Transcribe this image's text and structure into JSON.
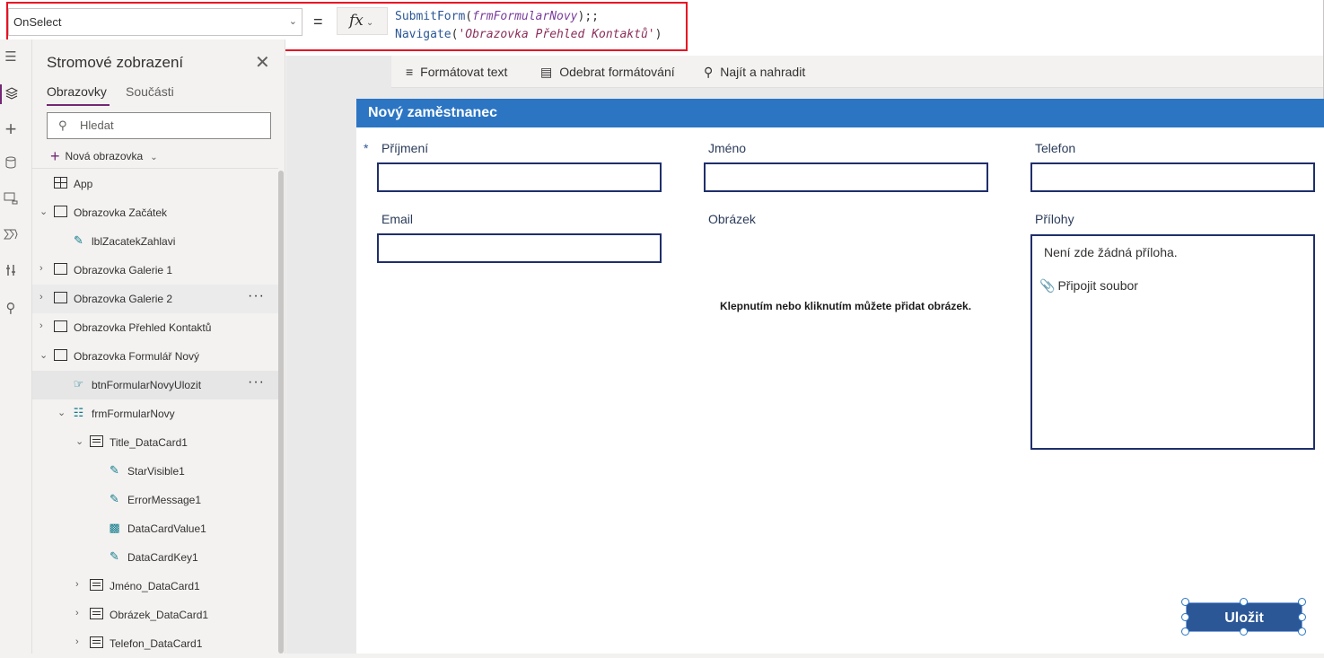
{
  "formula_bar": {
    "property": "OnSelect",
    "equals": "=",
    "fx": "fx",
    "line1": {
      "fn": "SubmitForm",
      "open": "(",
      "arg": "frmFormularNovy",
      "close": ");;"
    },
    "line2": {
      "fn": "Navigate",
      "open": "(",
      "arg": "'Obrazovka Přehled Kontaktů'",
      "close": ")"
    }
  },
  "rail": {
    "icons": [
      "hamburger-icon",
      "layers-icon",
      "plus-icon",
      "database-icon",
      "media-icon",
      "flow-icon",
      "tools-icon",
      "search-icon"
    ]
  },
  "tree": {
    "title": "Stromové zobrazení",
    "tabs": [
      {
        "label": "Obrazovky",
        "active": true
      },
      {
        "label": "Součásti",
        "active": false
      }
    ],
    "search_placeholder": "Hledat",
    "new_screen_label": "Nová obrazovka",
    "nodes": [
      {
        "label": "App"
      },
      {
        "label": "Obrazovka Začátek"
      },
      {
        "label": "lblZacatekZahlavi"
      },
      {
        "label": "Obrazovka Galerie 1"
      },
      {
        "label": "Obrazovka Galerie 2"
      },
      {
        "label": "Obrazovka Přehled Kontaktů"
      },
      {
        "label": "Obrazovka Formulář Nový"
      },
      {
        "label": "btnFormularNovyUlozit"
      },
      {
        "label": "frmFormularNovy"
      },
      {
        "label": "Title_DataCard1"
      },
      {
        "label": "StarVisible1"
      },
      {
        "label": "ErrorMessage1"
      },
      {
        "label": "DataCardValue1"
      },
      {
        "label": "DataCardKey1"
      },
      {
        "label": "Jméno_DataCard1"
      },
      {
        "label": "Obrázek_DataCard1"
      },
      {
        "label": "Telefon_DataCard1"
      }
    ]
  },
  "format_toolbar": {
    "format_text": "Formátovat text",
    "remove_formatting": "Odebrat formátování",
    "find_replace": "Najít a nahradit"
  },
  "form": {
    "title": "Nový zaměstnanec",
    "required_star": "*",
    "fields": {
      "prijmeni": "Příjmení",
      "jmeno": "Jméno",
      "telefon": "Telefon",
      "email": "Email",
      "obrazek": "Obrázek",
      "prilohy": "Přílohy"
    },
    "image_hint": "Klepnutím nebo kliknutím můžete přidat obrázek.",
    "attachments_empty": "Není zde žádná příloha.",
    "attach_file": "Připojit soubor",
    "save_button": "Uložit"
  },
  "colors": {
    "accent": "#742774",
    "form_header": "#2b75c3",
    "button": "#2b5797",
    "highlight_box": "#e81123"
  }
}
